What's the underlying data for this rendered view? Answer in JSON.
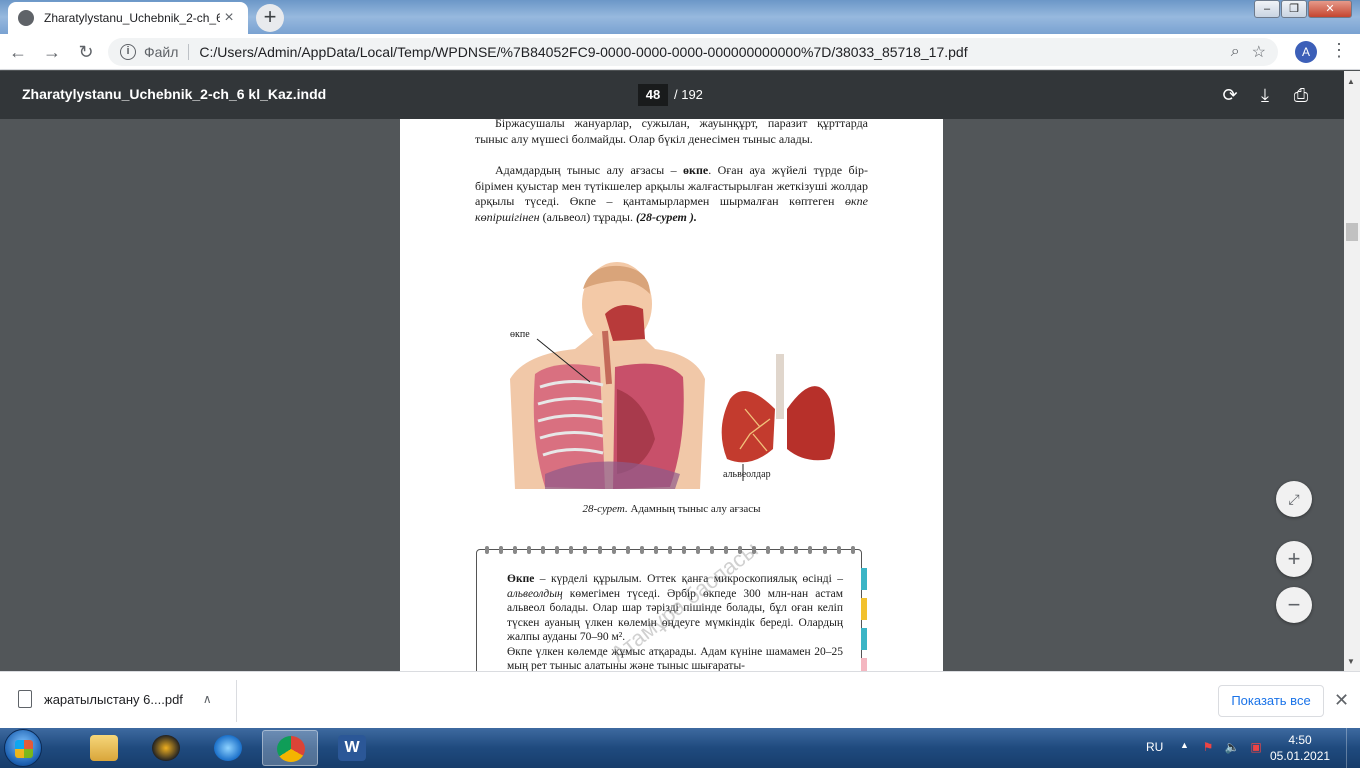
{
  "browser": {
    "tab_title": "Zharatylystanu_Uchebnik_2-ch_6",
    "scheme_label": "Файл",
    "url": "C:/Users/Admin/AppData/Local/Temp/WPDNSE/%7B84052FC9-0000-0000-0000-000000000000%7D/38033_85718_17.pdf",
    "avatar_letter": "A"
  },
  "pdf": {
    "doc_title": "Zharatylystanu_Uchebnik_2-ch_6 kl_Kaz.indd",
    "current_page": "48",
    "total_pages": "/ 192"
  },
  "page": {
    "para1": "Біржасушалы жануарлар, сужылан, жауынқұрт, паразит құрттарда тыныс алу мүшесі болмайды. Олар бүкіл денесімен тыныс алады.",
    "para2_a": "Адамдардың тыныс алу ағзасы – ",
    "para2_bold": "өкпе",
    "para2_b": ". Оған ауа жүйелі түрде бір-бірімен қуыстар мен түтікшелер арқылы жалғастырылған жеткізуші жолдар арқылы түседі. Өкпе – қантамырлармен шырмалған көптеген ",
    "para2_italic": "өкпе көпіршігінен",
    "para2_c": " (альвеол) тұрады. ",
    "para2_ref": "(28-сурет ).",
    "label_lung": "өкпе",
    "label_alveoli": "альвеолдар",
    "caption_italic": "28-сурет.",
    "caption_text": " Адамның тыныс алу ағзасы",
    "note_bold": "Өкпе",
    "note_a": " – күрделі құрылым. Оттек қанға микроскопиялық өсінді – ",
    "note_italic": "альвеолдың",
    "note_b": " көмегімен түседі. Әрбір өкпеде 300 млн-нан астам альвеол болады. Олар шар тәрізді пішінде болады, бұл оған келіп түскен ауаның үлкен көлемін өңдеуге мүмкіндік береді. Олардың жалпы ауданы 70–90 м².",
    "note_p2": "Өкпе үлкен көлемде жұмыс атқарады. Адам күніне шамамен 20–25 мың рет тыныс алатыны және тыныс шығараты-",
    "watermark": "Атамұра баспасы"
  },
  "download": {
    "filename": "жаратылыстану 6....pdf",
    "show_all": "Показать все"
  },
  "taskbar": {
    "lang": "RU",
    "time": "4:50",
    "date": "05.01.2021"
  },
  "colors": {
    "pdf_toolbar": "#323639",
    "viewer_bg": "#525659",
    "accent": "#1a73e8"
  }
}
